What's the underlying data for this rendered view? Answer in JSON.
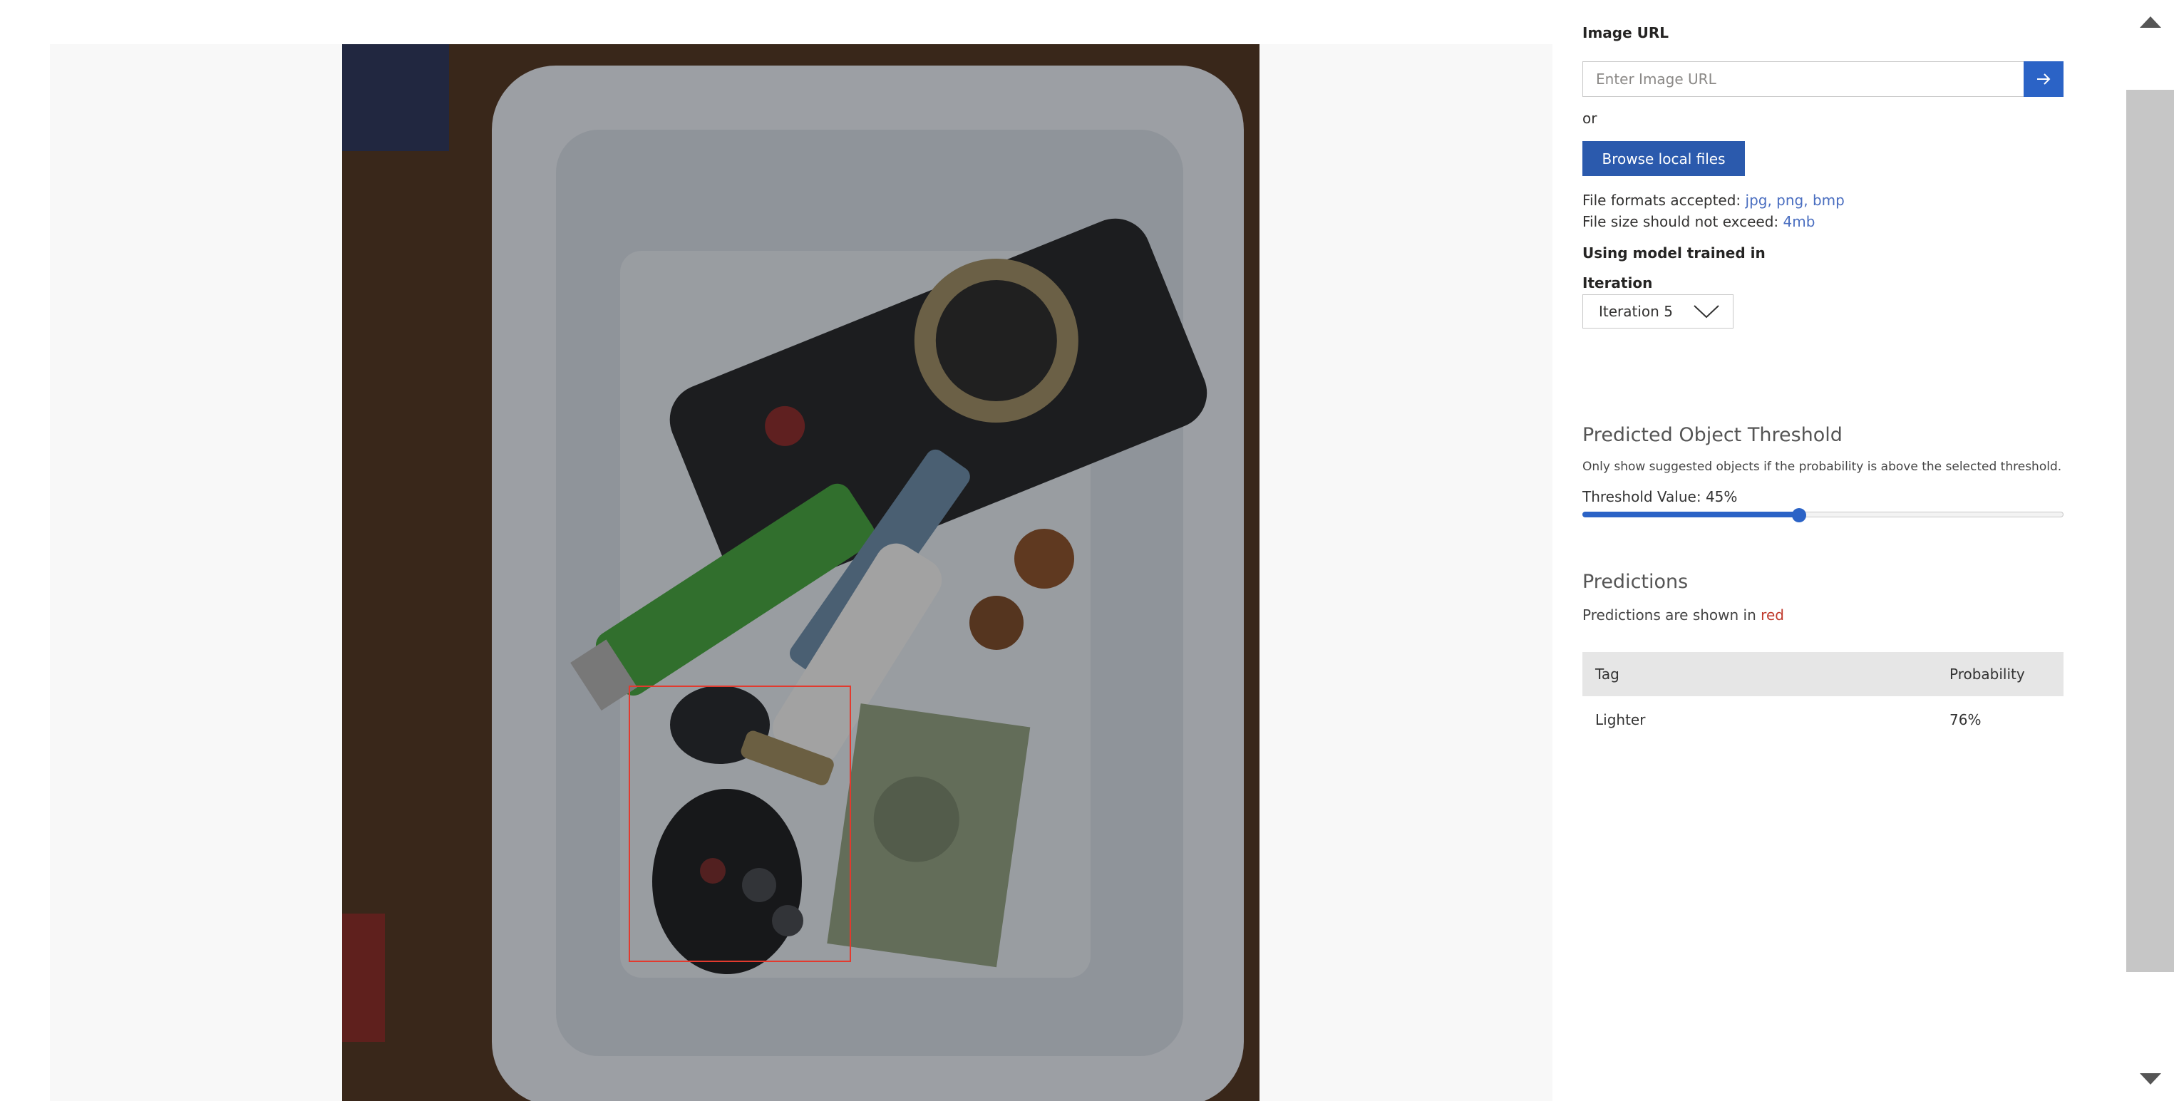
{
  "image_panel": {
    "prediction_box_color": "#e23a2e"
  },
  "panel": {
    "url_label": "Image URL",
    "url_placeholder": "Enter Image URL",
    "url_value": "",
    "go_icon": "arrow-right-icon",
    "or_text": "or",
    "browse_label": "Browse local files",
    "formats_prefix": "File formats accepted: ",
    "formats_value": "jpg, png, bmp",
    "size_prefix": "File size should not exceed: ",
    "size_value": "4mb",
    "model_label": "Using model trained in",
    "iteration_label": "Iteration",
    "iteration_selected": "Iteration 5",
    "threshold_title": "Predicted Object Threshold",
    "threshold_desc": "Only show suggested objects if the probability is above the selected threshold.",
    "threshold_label": "Threshold Value: 45%",
    "threshold_fraction": 0.45,
    "predictions_title": "Predictions",
    "predictions_note_prefix": "Predictions are shown in ",
    "predictions_note_color": "red",
    "table": {
      "headers": [
        "Tag",
        "Probability"
      ],
      "rows": [
        {
          "tag": "Lighter",
          "probability": "76%"
        }
      ]
    }
  },
  "colors": {
    "accent": "#2b63c6",
    "button": "#2b5aad",
    "link": "#4a6ec0",
    "red": "#c0392b"
  }
}
